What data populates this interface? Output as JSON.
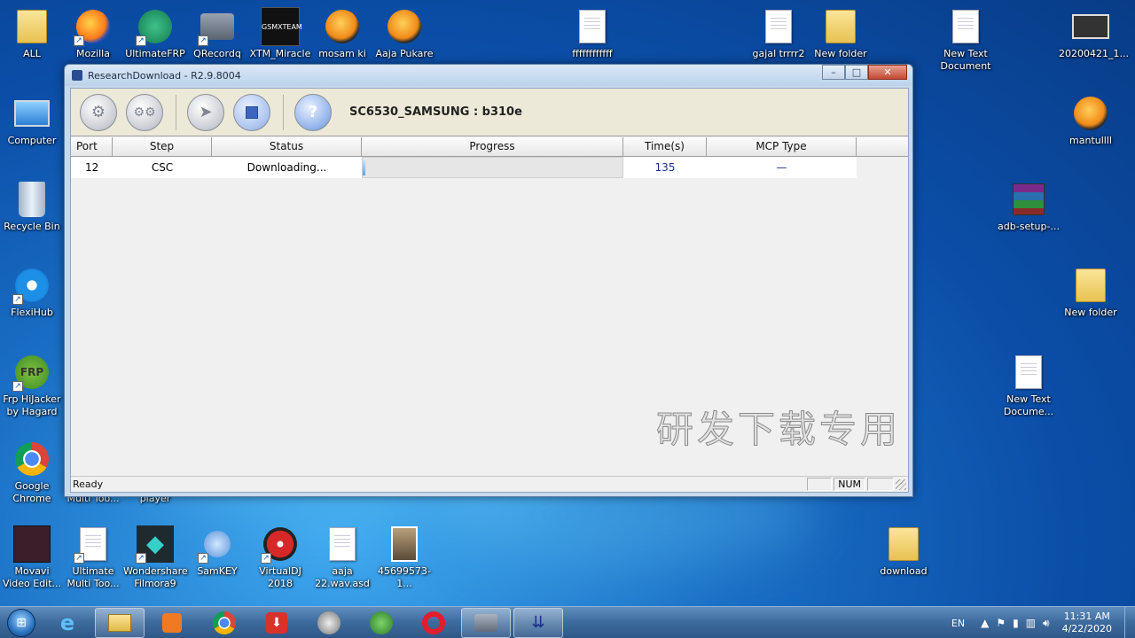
{
  "desktop": {
    "left_icons": [
      {
        "label": "ALL",
        "icon": "user-folder-icon"
      },
      {
        "label": "Mozilla",
        "icon": "firefox-icon"
      },
      {
        "label": "UltimateFRP",
        "icon": "shield-refresh-icon"
      },
      {
        "label": "QRecordq",
        "icon": "camcorder-icon"
      },
      {
        "label": "XTM_Miracle",
        "icon": "gsmxteam-icon"
      },
      {
        "label": "mosam ki",
        "icon": "fl-studio-icon"
      },
      {
        "label": "Aaja Pukare",
        "icon": "fl-studio-icon"
      }
    ],
    "mid_icons": [
      {
        "label": "ffffffffffff",
        "icon": "mp3-icon"
      },
      {
        "label": "gajal trrrr2",
        "icon": "mp3-icon"
      },
      {
        "label": "New folder",
        "icon": "folder-icon"
      },
      {
        "label": "New Text Document",
        "icon": "text-document-icon"
      },
      {
        "label": "20200421_1...",
        "icon": "video-file-icon"
      }
    ],
    "column_icons": [
      {
        "label": "Computer",
        "icon": "computer-icon"
      },
      {
        "label": "Recycle Bin",
        "icon": "recycle-bin-icon"
      },
      {
        "label": "FlexiHub",
        "icon": "flexihub-icon"
      },
      {
        "label": "Frp HiJacker by Hagard",
        "icon": "frp-hijacker-icon"
      },
      {
        "label": "Google Chrome",
        "icon": "chrome-icon"
      }
    ],
    "right_icons": [
      {
        "label": "mantullll",
        "icon": "fl-studio-icon"
      },
      {
        "label": "adb-setup-...",
        "icon": "winrar-icon"
      },
      {
        "label": "New folder",
        "icon": "folder-icon"
      },
      {
        "label": "New Text Docume...",
        "icon": "text-document-icon"
      }
    ],
    "bottom_icons": [
      {
        "label": "Movavi Video Edit...",
        "icon": "movavi-icon"
      },
      {
        "label": "Ultimate Multi Too...",
        "icon": "ultimate-multi-tool-icon"
      },
      {
        "label": "Wondershare Filmora9",
        "icon": "filmora-icon"
      },
      {
        "label": "SamKEY",
        "icon": "samkey-icon"
      },
      {
        "label": "VirtualDJ 2018",
        "icon": "virtualdj-icon"
      },
      {
        "label": "aaja 22.wav.asd",
        "icon": "asd-file-icon"
      },
      {
        "label": "45699573-1...",
        "icon": "image-file-icon"
      },
      {
        "label": "download",
        "icon": "folder-icon"
      }
    ],
    "hidden_labels": [
      "Multi Too...",
      "player"
    ]
  },
  "window": {
    "title": "ResearchDownload - R2.9.8004",
    "controls": {
      "minimize": "–",
      "maximize": "□",
      "close": "✕"
    },
    "toolbar": {
      "buttons": [
        "load-packet-icon",
        "settings-icon",
        "start-download-icon",
        "stop-icon",
        "help-icon"
      ],
      "model_label": "SC6530_SAMSUNG : b310e"
    },
    "grid": {
      "columns": [
        "Port",
        "Step",
        "Status",
        "Progress",
        "Time(s)",
        "MCP Type"
      ],
      "rows": [
        {
          "port": "12",
          "step": "CSC",
          "status": "Downloading...",
          "progress_percent": 1,
          "time": "135",
          "mcp": "—"
        }
      ]
    },
    "watermark": "研发下载专用",
    "statusbar": {
      "text": "Ready",
      "pane_num": "NUM"
    }
  },
  "taskbar": {
    "apps": [
      "internet-explorer-icon",
      "file-explorer-icon",
      "media-player-icon",
      "chrome-icon",
      "idm-icon",
      "itunes-icon",
      "network-icon",
      "opera-icon",
      "camcorder-icon",
      "research-download-icon"
    ],
    "active_index": 9,
    "tray": {
      "language": "EN",
      "time": "11:31 AM",
      "date": "4/22/2020"
    }
  }
}
